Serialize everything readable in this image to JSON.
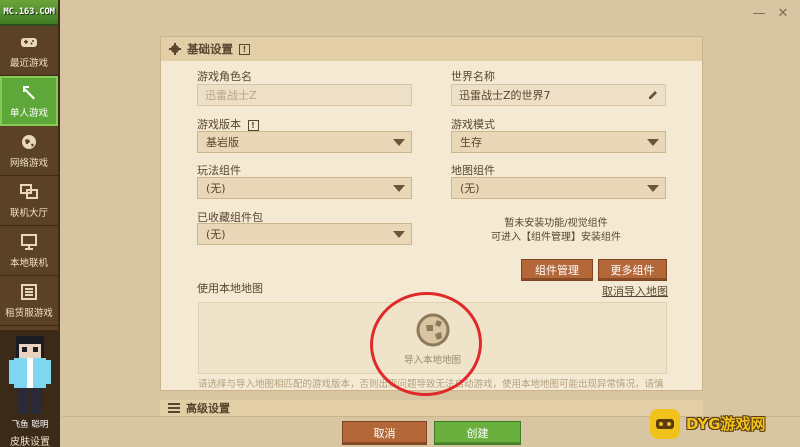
{
  "logo": "MC.163.COM",
  "sidebar": {
    "items": [
      {
        "label": "最近游戏",
        "icon": "gamepad-icon"
      },
      {
        "label": "单人游戏",
        "icon": "pickaxe-icon",
        "active": true
      },
      {
        "label": "网络游戏",
        "icon": "globe-icon"
      },
      {
        "label": "联机大厅",
        "icon": "lobby-icon"
      },
      {
        "label": "本地联机",
        "icon": "monitor-icon"
      },
      {
        "label": "租赁服游戏",
        "icon": "server-icon"
      }
    ],
    "player_name": "飞鱼 聪明",
    "skin_button": "皮肤设置"
  },
  "window": {
    "minimize": "—",
    "close": "✕"
  },
  "basic_settings": {
    "title": "基础设置",
    "role_name_label": "游戏角色名",
    "role_name_value": "迅雷战士Z",
    "world_name_label": "世界名称",
    "world_name_value": "迅雷战士Z的世界7",
    "version_label": "游戏版本",
    "version_value": "基岩版",
    "mode_label": "游戏模式",
    "mode_value": "生存",
    "gameplay_label": "玩法组件",
    "gameplay_value": "(无)",
    "map_comp_label": "地图组件",
    "map_comp_value": "(无)",
    "fav_pack_label": "已收藏组件包",
    "fav_pack_value": "(无)",
    "notice_line1": "暂未安装功能/视觉组件",
    "notice_line2": "可进入【组件管理】安装组件",
    "manage_btn": "组件管理",
    "more_btn": "更多组件",
    "local_map_label": "使用本地地图",
    "cancel_import": "取消导入地图",
    "import_map": "导入本地地图",
    "warning": "请选择与导入地图相匹配的游戏版本，否则出现问题导致无法启动游戏，使用本地地图可能出现异常情况，请慎重使用本功能。"
  },
  "advanced": {
    "title": "高级设置"
  },
  "footer": {
    "cancel": "取消",
    "create": "创建"
  },
  "watermark": "DYG游戏网",
  "colors": {
    "accent_green": "#6ab03f",
    "brown_button": "#b4683a",
    "annotation_red": "#e02a2a"
  }
}
